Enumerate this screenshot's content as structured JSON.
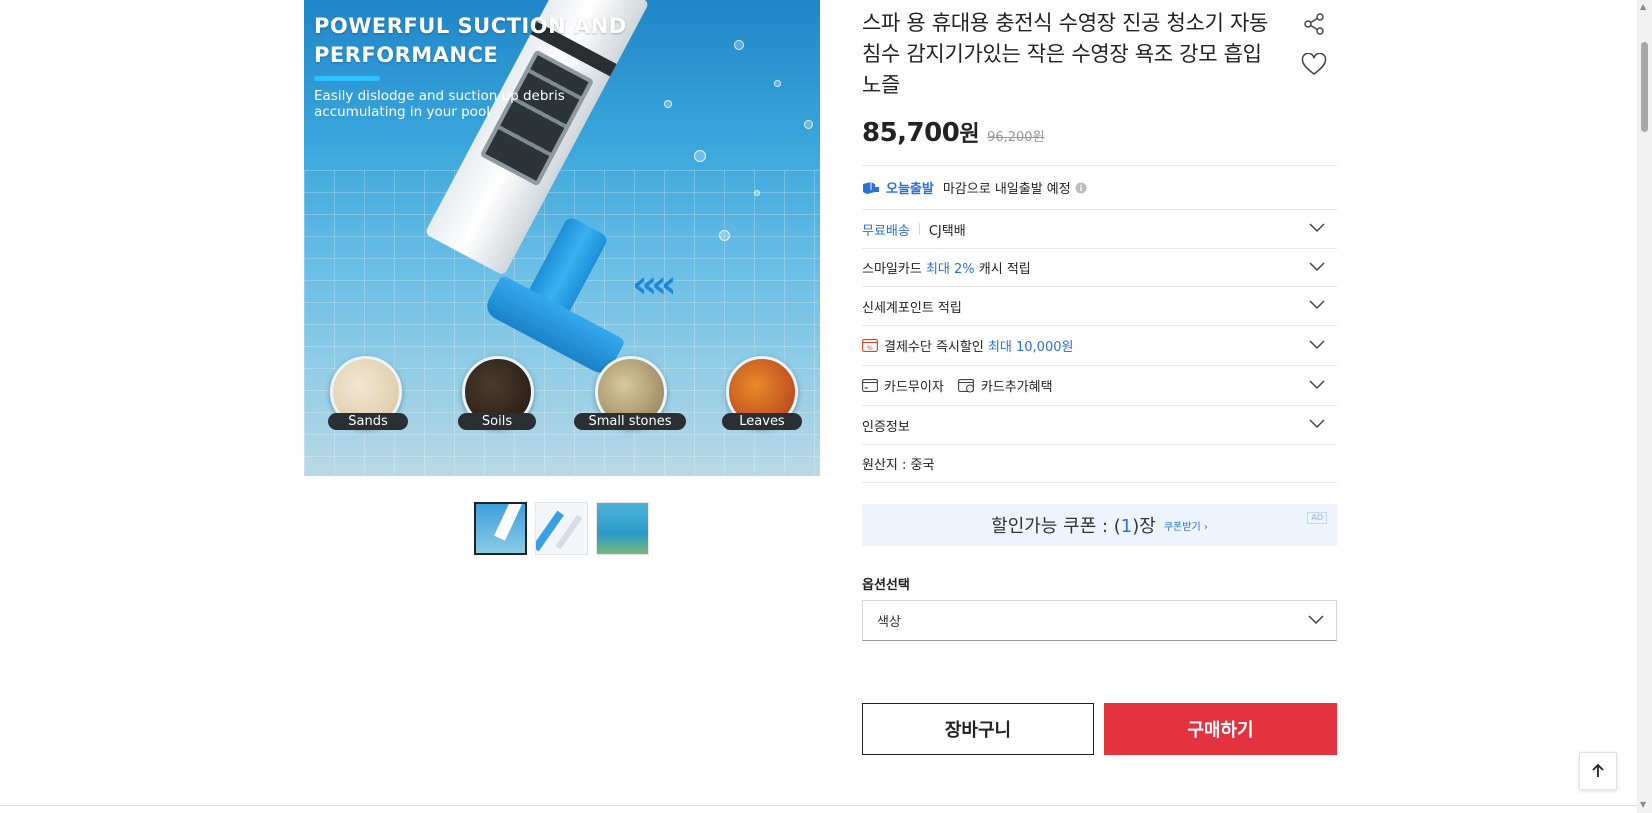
{
  "gallery": {
    "headline": "POWERFUL SUCTION AND PERFORMANCE",
    "subline": "Easily dislodge and suction up debris accumulating in your pool",
    "debris_labels": [
      "Sands",
      "Soils",
      "Small stones",
      "Leaves"
    ],
    "thumbnail_count": 3,
    "active_thumbnail": 1
  },
  "product": {
    "title": "스파 용 휴대용 충전식 수영장 진공 청소기 자동 침수 감지기가있는 작은 수영장 욕조 강모 흡입 노즐",
    "price": "85,700",
    "price_unit": "원",
    "original_price": "96,200원"
  },
  "delivery": {
    "badge": "오늘출발",
    "note": "마감으로 내일출발 예정"
  },
  "shipping": {
    "free_label": "무료배송",
    "carrier": "CJ택배"
  },
  "smilecard": {
    "prefix": "스마일카드",
    "highlight": "최대 2%",
    "suffix": "캐시 적립"
  },
  "points": {
    "label": "신세계포인트 적립"
  },
  "instant_discount": {
    "label": "결제수단 즉시할인",
    "highlight": "최대 10,000원"
  },
  "card_benefits": {
    "no_interest": "카드무이자",
    "extra": "카드추가혜택"
  },
  "certification": {
    "label": "인증정보"
  },
  "origin": {
    "label": "원산지 : 중국"
  },
  "coupon": {
    "text_before": "할인가능 쿠폰 : (",
    "count": "1",
    "text_after": ")장",
    "link": "쿠폰받기 ›",
    "ad": "AD"
  },
  "options": {
    "label": "옵션선택",
    "select_value": "색상"
  },
  "actions": {
    "cart": "장바구니",
    "buy": "구매하기"
  },
  "colors": {
    "accent_blue": "#2b72d8",
    "buy_red": "#e5323f",
    "coupon_bg": "#eef4fd"
  },
  "icons": [
    "share-icon",
    "heart-icon",
    "delivery-truck-icon",
    "info-icon",
    "chevron-down-icon",
    "discount-card-icon",
    "card-icon",
    "card-benefit-icon",
    "arrow-up-icon"
  ]
}
